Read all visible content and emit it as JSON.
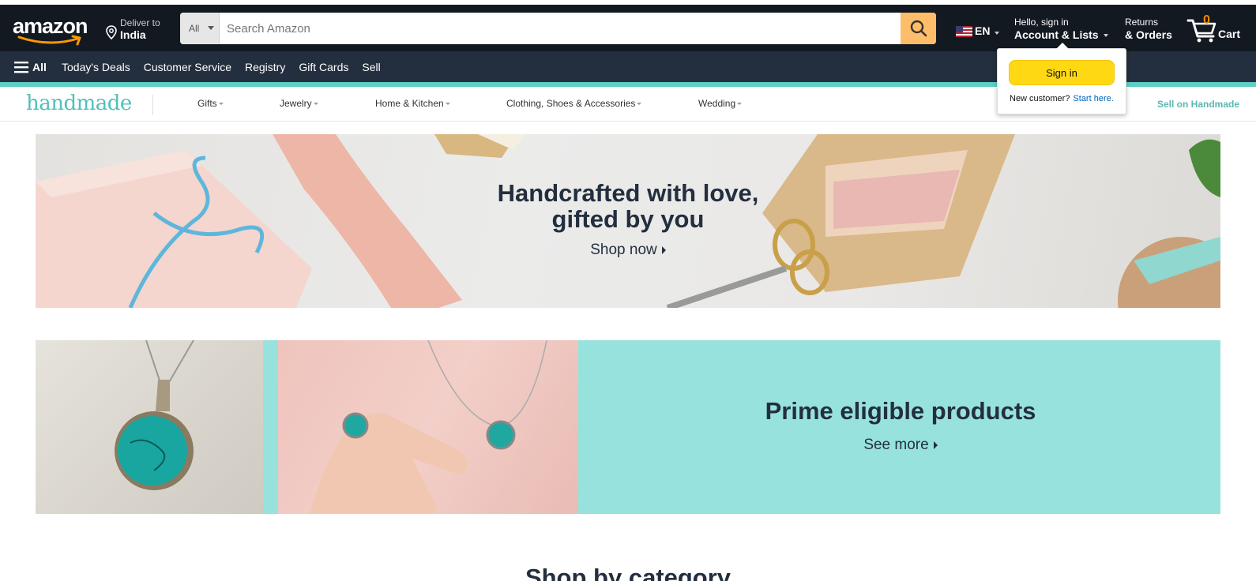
{
  "header": {
    "logo_text": "amazon",
    "deliver_line1": "Deliver to",
    "deliver_line2": "India",
    "search_category": "All",
    "search_placeholder": "Search Amazon",
    "language": "EN",
    "account_line1": "Hello, sign in",
    "account_line2": "Account & Lists",
    "returns_line1": "Returns",
    "returns_line2": "& Orders",
    "cart_count": "0",
    "cart_label": "Cart"
  },
  "nav_main": {
    "all_label": "All",
    "links": [
      "Today's Deals",
      "Customer Service",
      "Registry",
      "Gift Cards",
      "Sell"
    ]
  },
  "handmade_nav": {
    "logo": "handmade",
    "items": [
      "Gifts",
      "Jewelry",
      "Home & Kitchen",
      "Clothing, Shoes & Accessories",
      "Wedding"
    ],
    "sell_link": "Sell on Handmade"
  },
  "signin_flyout": {
    "button": "Sign in",
    "new_customer": "New customer?",
    "start_here": "Start here."
  },
  "hero": {
    "title_line1": "Handcrafted with love,",
    "title_line2": "gifted by you",
    "cta": "Shop now"
  },
  "prime_banner": {
    "title": "Prime eligible products",
    "cta": "See more"
  },
  "section_heading": "Shop by category",
  "colors": {
    "nav_belt": "#131921",
    "nav_main": "#232f3e",
    "teal_accent": "#5ecec5",
    "search_button": "#febd69",
    "signin_button": "#ffd814",
    "cart_count": "#f08804",
    "prime_bg": "#98e2dd"
  }
}
